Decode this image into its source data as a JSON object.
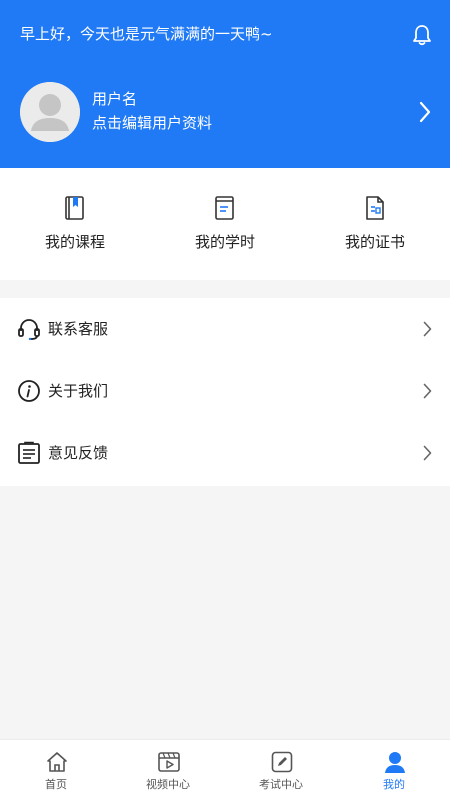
{
  "header": {
    "greeting": "早上好，今天也是元气满满的一天鸭~",
    "username": "用户名",
    "edit_hint": "点击编辑用户资料"
  },
  "quick_links": [
    {
      "label": "我的课程",
      "icon": "course-book-icon"
    },
    {
      "label": "我的学时",
      "icon": "study-hours-icon"
    },
    {
      "label": "我的证书",
      "icon": "certificate-icon"
    }
  ],
  "menu": [
    {
      "label": "联系客服",
      "icon": "headset-icon"
    },
    {
      "label": "关于我们",
      "icon": "info-icon"
    },
    {
      "label": "意见反馈",
      "icon": "feedback-icon"
    }
  ],
  "tabbar": [
    {
      "label": "首页",
      "icon": "home-icon",
      "active": false
    },
    {
      "label": "视频中心",
      "icon": "video-icon",
      "active": false
    },
    {
      "label": "考试中心",
      "icon": "exam-icon",
      "active": false
    },
    {
      "label": "我的",
      "icon": "profile-icon",
      "active": true
    }
  ],
  "colors": {
    "accent": "#2079f5",
    "background": "#f5f5f5",
    "text": "#222222"
  }
}
